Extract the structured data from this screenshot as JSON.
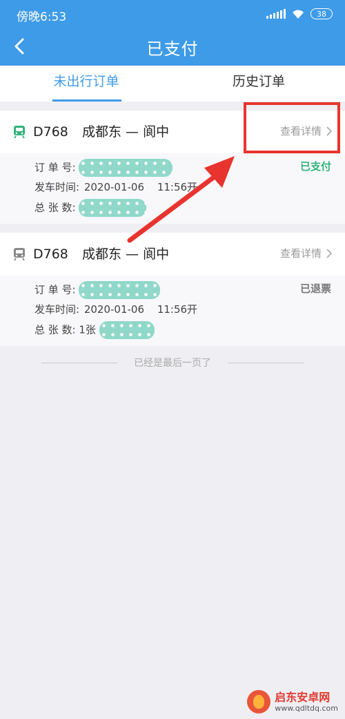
{
  "status_bar": {
    "time": "傍晚6:53",
    "battery": "38"
  },
  "header": {
    "title": "已支付"
  },
  "tabs": [
    {
      "label": "未出行订单",
      "active": true
    },
    {
      "label": "历史订单",
      "active": false
    }
  ],
  "orders": [
    {
      "train": "D768",
      "from": "成都东",
      "separator": "—",
      "to": "阆中",
      "detail_label": "查看详情",
      "order_no_label": "订 单 号:",
      "depart_label": "发车时间:",
      "depart_date": "2020-01-06",
      "depart_time": "11:56开",
      "tickets_label": "总 张 数:",
      "tickets_value": "",
      "status": "已支付"
    },
    {
      "train": "D768",
      "from": "成都东",
      "separator": "—",
      "to": "阆中",
      "detail_label": "查看详情",
      "order_no_label": "订 单 号:",
      "depart_label": "发车时间:",
      "depart_date": "2020-01-06",
      "depart_time": "11:56开",
      "tickets_label": "总 张 数:",
      "tickets_value": "1张",
      "status": "已退票"
    }
  ],
  "footer": {
    "text": "已经是最后一页了"
  },
  "watermark": {
    "name": "启东安卓网",
    "url": "www.qdltdq.com"
  },
  "colors": {
    "header_blue": "#3e9be8",
    "paid_green": "#31b37a",
    "annotation_red": "#e8342e",
    "train_icon_active": "#31b37a",
    "train_icon_inactive": "#888888"
  }
}
